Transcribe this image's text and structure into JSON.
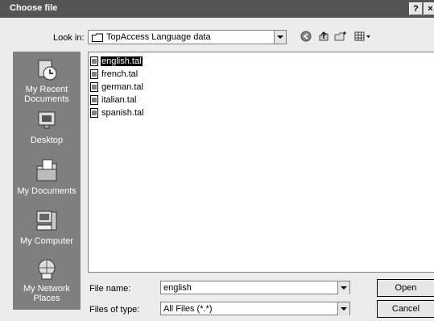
{
  "window": {
    "title": "Choose file",
    "help_button": "?",
    "close_button": "×"
  },
  "toolbar": {
    "look_in_label": "Look in:",
    "look_in_value": "TopAccess Language data"
  },
  "places": [
    {
      "label": "My Recent Documents",
      "icon": "recent-documents-icon"
    },
    {
      "label": "Desktop",
      "icon": "desktop-icon"
    },
    {
      "label": "My Documents",
      "icon": "my-documents-icon"
    },
    {
      "label": "My Computer",
      "icon": "my-computer-icon"
    },
    {
      "label": "My Network Places",
      "icon": "network-places-icon"
    }
  ],
  "files": [
    {
      "name": "english.tal",
      "selected": true
    },
    {
      "name": "french.tal",
      "selected": false
    },
    {
      "name": "german.tal",
      "selected": false
    },
    {
      "name": "italian.tal",
      "selected": false
    },
    {
      "name": "spanish.tal",
      "selected": false
    }
  ],
  "form": {
    "file_name_label": "File name:",
    "file_name_value": "english",
    "files_of_type_label": "Files of type:",
    "files_of_type_value": "All Files (*.*)"
  },
  "buttons": {
    "open": "Open",
    "cancel": "Cancel"
  }
}
